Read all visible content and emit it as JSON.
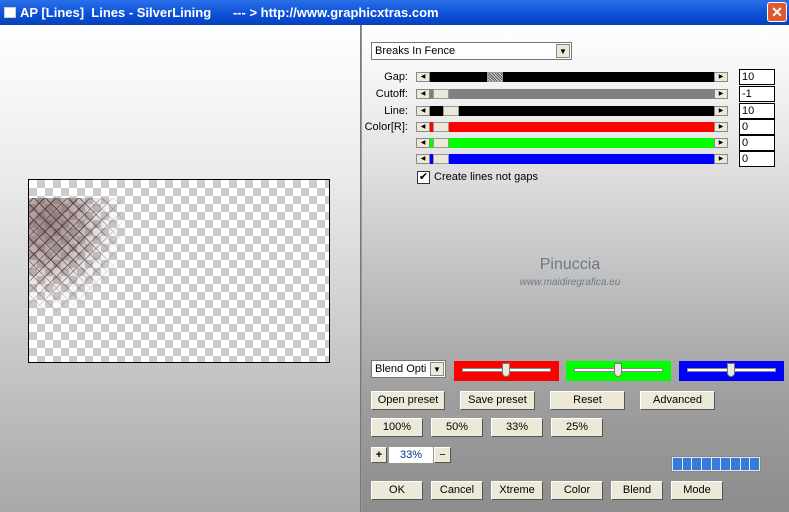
{
  "window": {
    "title": "AP [Lines]  Lines - SilverLining      --- > http://www.graphicxtras.com",
    "close_icon": "close-icon"
  },
  "preset_dropdown": {
    "value": "Breaks In Fence"
  },
  "sliders": [
    {
      "label": "Gap:",
      "value": "10",
      "color": "#000000"
    },
    {
      "label": "Cutoff:",
      "value": "-1",
      "color": "#808080"
    },
    {
      "label": "Line:",
      "value": "10",
      "color": "#000000"
    },
    {
      "label": "Color[R]:",
      "value": "0",
      "color": "#ff0000"
    },
    {
      "label": "",
      "value": "0",
      "color": "#00ff00"
    },
    {
      "label": "",
      "value": "0",
      "color": "#0000ff"
    }
  ],
  "checkbox": {
    "label": "Create lines not gaps",
    "checked": true
  },
  "watermark": {
    "name": "Pinuccia",
    "url": "www.maidiregrafica.eu"
  },
  "blend_dropdown": {
    "value": "Blend Opti"
  },
  "buttons": {
    "open_preset": "Open preset",
    "save_preset": "Save preset",
    "reset": "Reset",
    "advanced": "Advanced",
    "z100": "100%",
    "z50": "50%",
    "z33": "33%",
    "z25": "25%",
    "plus": "+",
    "minus": "−",
    "zoom_value": "33%",
    "ok": "OK",
    "cancel": "Cancel",
    "xtreme": "Xtreme",
    "color": "Color",
    "blend": "Blend",
    "mode": "Mode"
  }
}
